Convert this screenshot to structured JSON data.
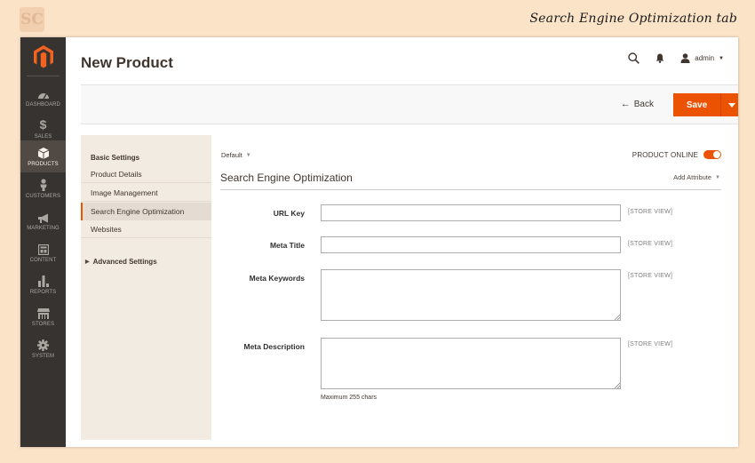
{
  "caption": "Search Engine Optimization tab",
  "header": {
    "title": "New Product",
    "admin_label": "admin"
  },
  "nav": [
    {
      "label": "DASHBOARD",
      "icon": "dashboard-icon"
    },
    {
      "label": "SALES",
      "icon": "dollar-icon"
    },
    {
      "label": "PRODUCTS",
      "icon": "cube-icon",
      "active": true
    },
    {
      "label": "CUSTOMERS",
      "icon": "person-icon"
    },
    {
      "label": "MARKETING",
      "icon": "megaphone-icon"
    },
    {
      "label": "CONTENT",
      "icon": "content-icon"
    },
    {
      "label": "REPORTS",
      "icon": "bar-chart-icon"
    },
    {
      "label": "STORES",
      "icon": "store-icon"
    },
    {
      "label": "SYSTEM",
      "icon": "gear-icon"
    }
  ],
  "actions": {
    "back_label": "Back",
    "save_label": "Save"
  },
  "left_panel": {
    "heading": "Basic Settings",
    "links": [
      {
        "label": "Product Details"
      },
      {
        "label": "Image Management"
      },
      {
        "label": "Search Engine Optimization",
        "active": true
      },
      {
        "label": "Websites"
      }
    ],
    "advanced_label": "Advanced Settings"
  },
  "main": {
    "scope_label": "Default",
    "online_label": "PRODUCT ONLINE",
    "online_enabled": true,
    "section_title": "Search Engine Optimization",
    "add_attribute_label": "Add Attribute",
    "fields": [
      {
        "label": "URL Key",
        "value": "",
        "scope": "[STORE VIEW]"
      },
      {
        "label": "Meta Title",
        "value": "",
        "scope": "[STORE VIEW]"
      },
      {
        "label": "Meta Keywords",
        "value": "",
        "scope": "[STORE VIEW]"
      },
      {
        "label": "Meta Description",
        "value": "",
        "scope": "[STORE VIEW]",
        "note": "Maximum 255 chars"
      }
    ]
  },
  "colors": {
    "accent": "#eb5202",
    "sidebar": "#373330",
    "page_background": "#fbe3c8"
  }
}
